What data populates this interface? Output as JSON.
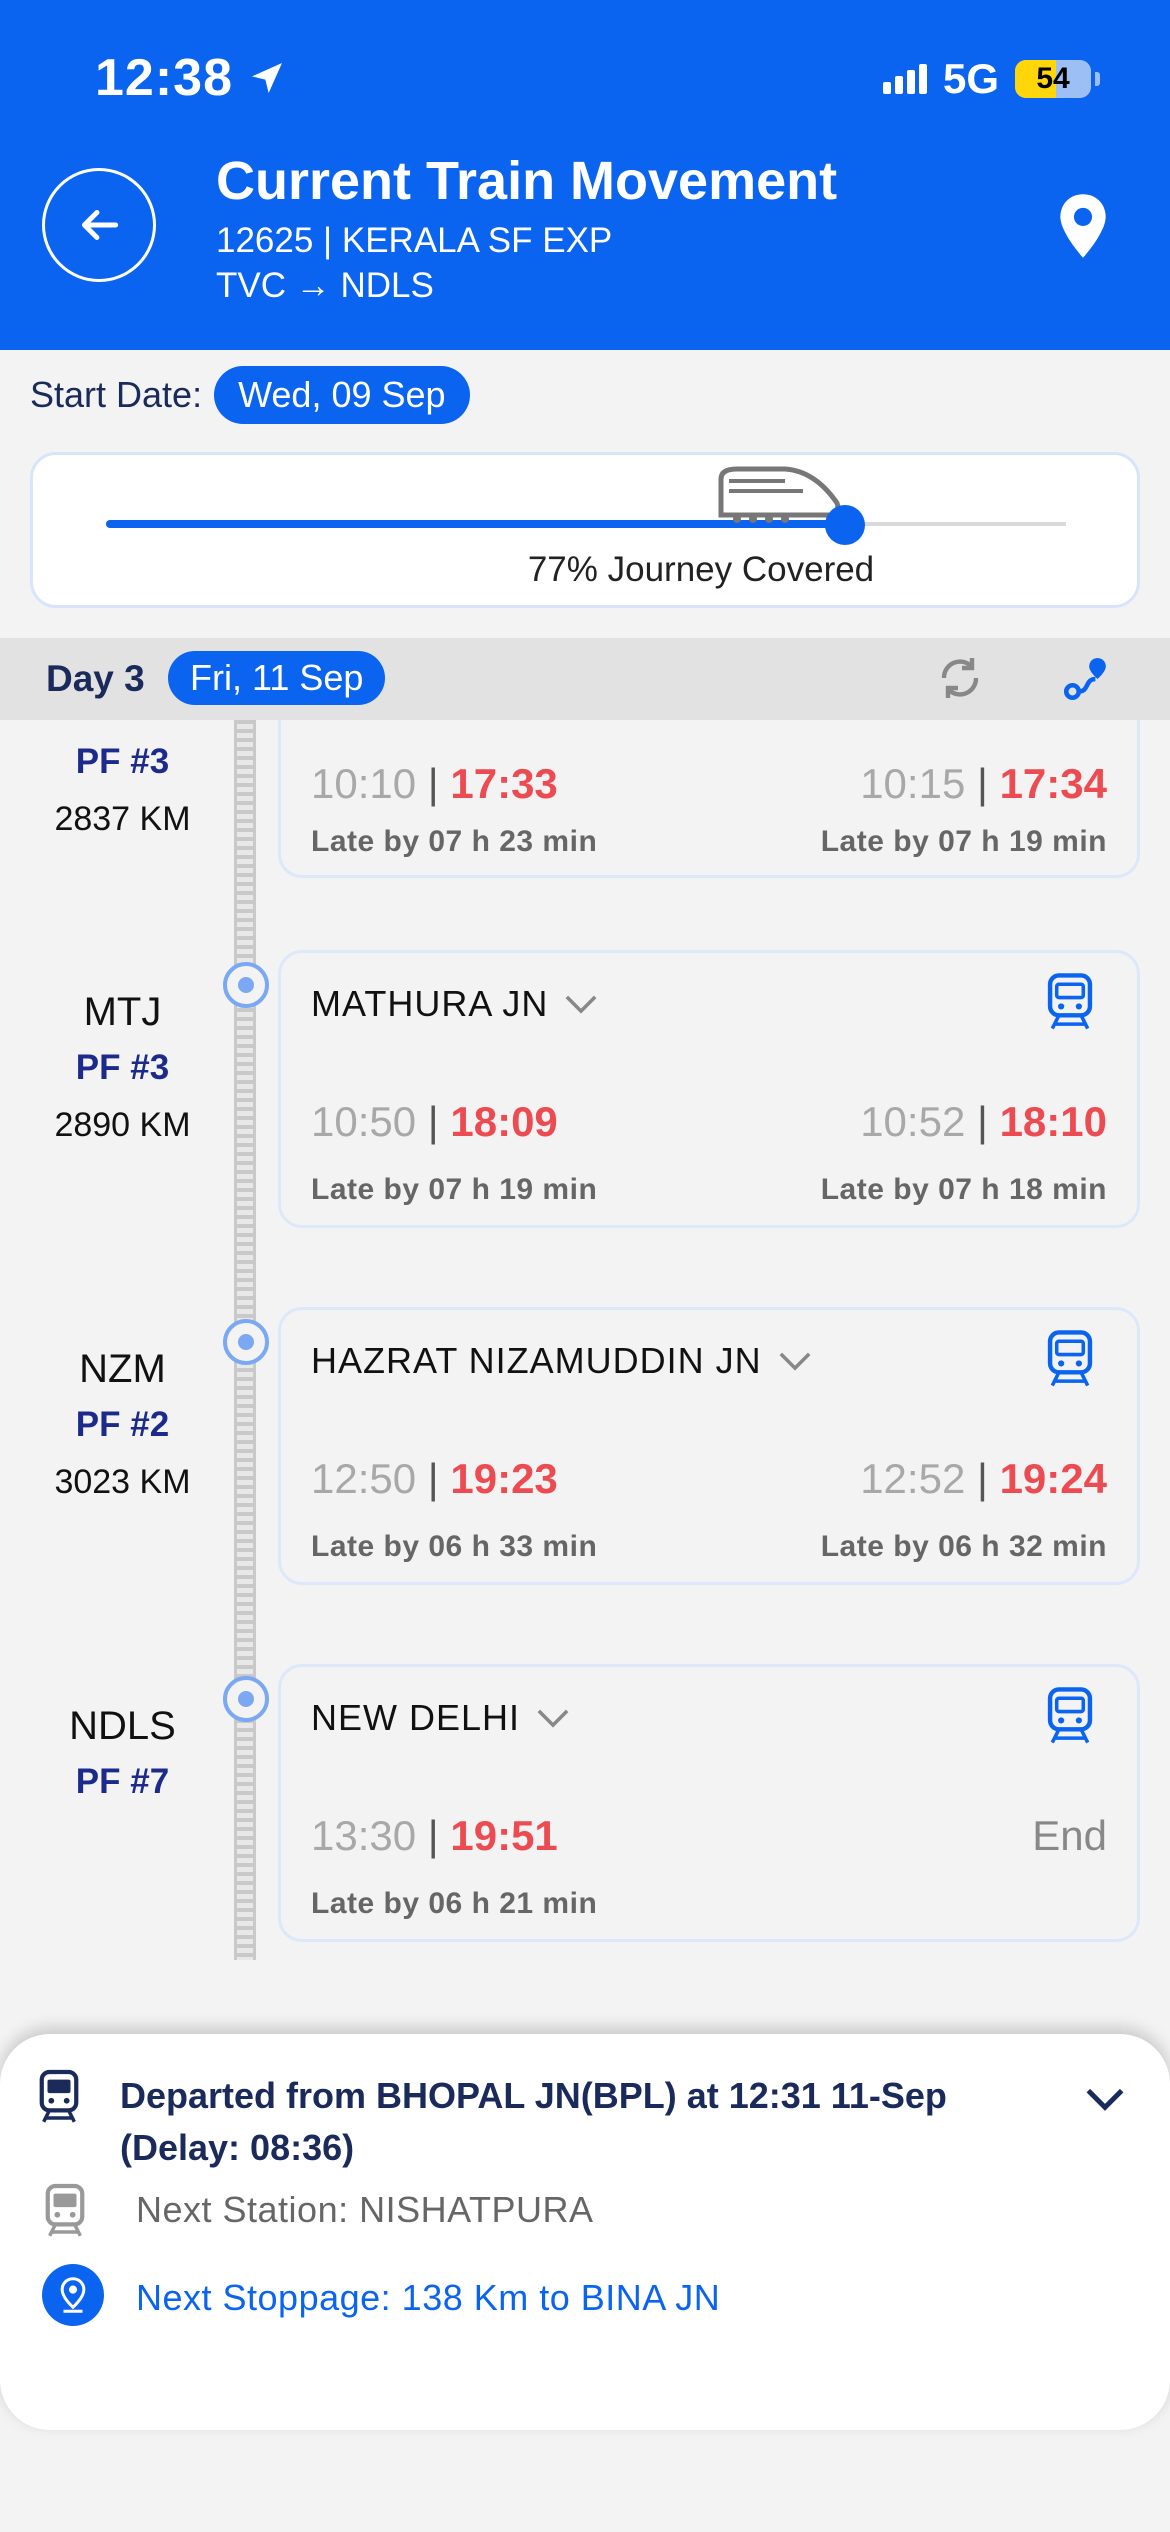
{
  "status_bar": {
    "time": "12:38",
    "network": "5G",
    "battery": "54"
  },
  "header": {
    "title": "Current Train Movement",
    "train": "12625 | KERALA SF EXP",
    "route": "TVC → NDLS"
  },
  "start_date": {
    "label": "Start Date:",
    "value": "Wed, 09 Sep"
  },
  "progress": {
    "percent": 77,
    "label": "77% Journey Covered"
  },
  "day": {
    "label": "Day 3",
    "date": "Fri, 11 Sep"
  },
  "stops": [
    {
      "code": "",
      "pf": "PF #3",
      "km": "2837 KM",
      "name": "",
      "arr_sched": "10:10",
      "arr_actual": "17:33",
      "arr_late": "Late by 07 h 23 min",
      "dep_sched": "10:15",
      "dep_actual": "17:34",
      "dep_late": "Late by 07 h 19 min"
    },
    {
      "code": "MTJ",
      "pf": "PF #3",
      "km": "2890 KM",
      "name": "MATHURA JN",
      "arr_sched": "10:50",
      "arr_actual": "18:09",
      "arr_late": "Late by 07 h 19 min",
      "dep_sched": "10:52",
      "dep_actual": "18:10",
      "dep_late": "Late by 07 h 18 min"
    },
    {
      "code": "NZM",
      "pf": "PF #2",
      "km": "3023 KM",
      "name": "HAZRAT NIZAMUDDIN JN",
      "arr_sched": "12:50",
      "arr_actual": "19:23",
      "arr_late": "Late by 06 h 33 min",
      "dep_sched": "12:52",
      "dep_actual": "19:24",
      "dep_late": "Late by 06 h 32 min"
    },
    {
      "code": "NDLS",
      "pf": "PF #7",
      "km": "",
      "name": "NEW DELHI",
      "arr_sched": "13:30",
      "arr_actual": "19:51",
      "arr_late": "Late by 06 h 21 min",
      "dep_end": "End"
    }
  ],
  "separator": "|",
  "bottom_sheet": {
    "departed": "Departed from BHOPAL JN(BPL) at 12:31 11-Sep (Delay: 08:36)",
    "next_station": "Next Station: NISHATPURA",
    "next_stoppage": "Next Stoppage: 138 Km to BINA JN"
  },
  "colors": {
    "primary": "#0a64f0",
    "late": "#ec4b52",
    "navy": "#1a2a5a"
  },
  "icons": [
    "location-arrow-icon",
    "signal-icon",
    "back-arrow-icon",
    "map-pin-icon",
    "train-icon",
    "refresh-icon",
    "route-icon",
    "station-train-icon",
    "chevron-down-icon",
    "stoppage-pin-icon"
  ]
}
